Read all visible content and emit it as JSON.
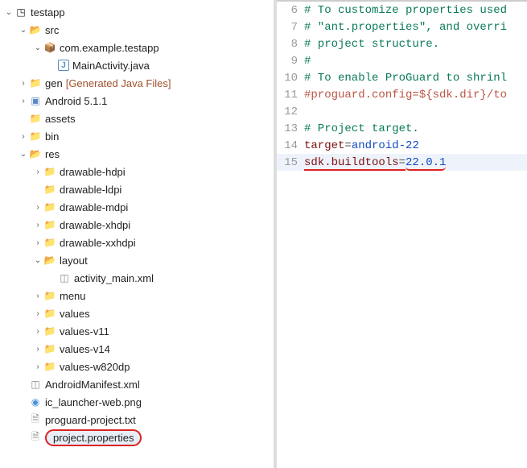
{
  "tree": {
    "root": {
      "label": "testapp"
    },
    "src": {
      "label": "src"
    },
    "package": {
      "label": "com.example.testapp"
    },
    "mainActivity": {
      "label": "MainActivity.java"
    },
    "gen": {
      "label": "gen",
      "suffix": "[Generated Java Files]"
    },
    "android": {
      "label": "Android 5.1.1"
    },
    "assets": {
      "label": "assets"
    },
    "bin": {
      "label": "bin"
    },
    "res": {
      "label": "res"
    },
    "drawableHdpi": {
      "label": "drawable-hdpi"
    },
    "drawableLdpi": {
      "label": "drawable-ldpi"
    },
    "drawableMdpi": {
      "label": "drawable-mdpi"
    },
    "drawableXhdpi": {
      "label": "drawable-xhdpi"
    },
    "drawableXxhdpi": {
      "label": "drawable-xxhdpi"
    },
    "layout": {
      "label": "layout"
    },
    "activityMain": {
      "label": "activity_main.xml"
    },
    "menu": {
      "label": "menu"
    },
    "values": {
      "label": "values"
    },
    "valuesV11": {
      "label": "values-v11"
    },
    "valuesV14": {
      "label": "values-v14"
    },
    "valuesW820dp": {
      "label": "values-w820dp"
    },
    "androidManifest": {
      "label": "AndroidManifest.xml"
    },
    "icLauncher": {
      "label": "ic_launcher-web.png"
    },
    "proguardProject": {
      "label": "proguard-project.txt"
    },
    "projectProperties": {
      "label": "project.properties"
    }
  },
  "editor": {
    "lines": [
      {
        "n": "6",
        "comment": "# To customize properties used"
      },
      {
        "n": "7",
        "comment": "# \"ant.properties\", and overri"
      },
      {
        "n": "8",
        "comment": "# project structure."
      },
      {
        "n": "9",
        "comment": "#"
      },
      {
        "n": "10",
        "comment": "# To enable ProGuard to shrinl"
      },
      {
        "n": "11",
        "directive": "#proguard.config=${sdk.dir}/to"
      },
      {
        "n": "12",
        "blank": ""
      },
      {
        "n": "13",
        "comment": "# Project target."
      },
      {
        "n": "14",
        "key": "target",
        "eq": "=",
        "val": "android-22"
      },
      {
        "n": "15",
        "key": "sdk.buildtools",
        "eq": "=",
        "val": "22.0.1"
      }
    ]
  },
  "icons": {
    "chevDown": "⌄",
    "chevRight": "›",
    "folderOpen": "📂",
    "folderClosed": "📁",
    "package": "📦",
    "javaFile": "J",
    "xmlFile": "◫",
    "txtFile": "🗎",
    "pngFile": "◉",
    "androidLib": "▣",
    "project": "◳"
  }
}
